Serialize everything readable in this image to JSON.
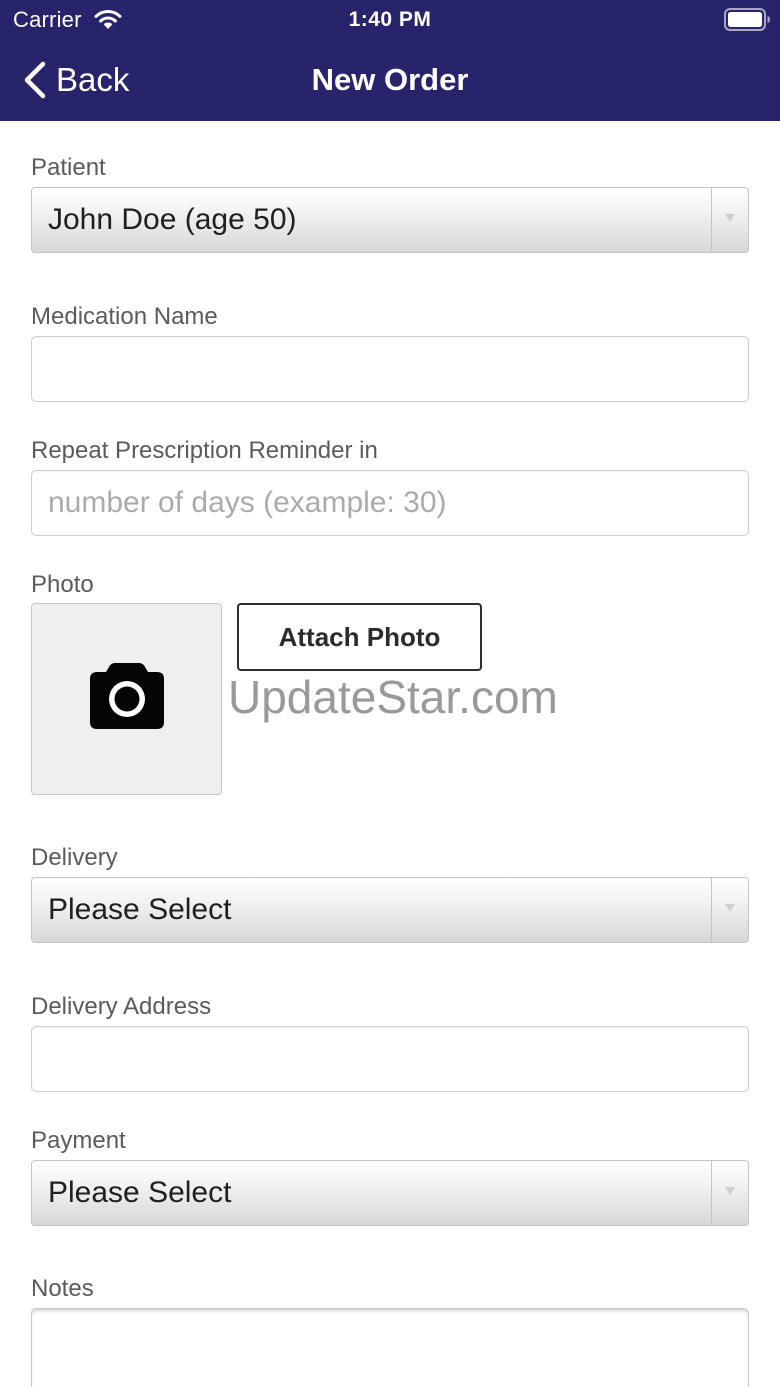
{
  "status_bar": {
    "carrier": "Carrier",
    "time": "1:40 PM",
    "wifi_icon": "wifi-icon",
    "battery_icon": "battery-icon"
  },
  "nav": {
    "back_icon": "chevron-left-icon",
    "back_label": "Back",
    "title": "New Order"
  },
  "colors": {
    "header_bg": "#28246c",
    "header_text": "#ffffff",
    "label_text": "#5b5b5b",
    "placeholder_text": "#ababab"
  },
  "form": {
    "patient": {
      "label": "Patient",
      "value": "John Doe (age 50)",
      "arrow_icon": "dropdown-arrow-icon"
    },
    "medication_name": {
      "label": "Medication Name",
      "value": ""
    },
    "reminder": {
      "label": "Repeat Prescription Reminder in",
      "value": "",
      "placeholder": "number of days (example: 30)"
    },
    "photo": {
      "label": "Photo",
      "icon": "camera-icon",
      "attach_label": "Attach Photo"
    },
    "delivery": {
      "label": "Delivery",
      "value": "Please Select",
      "arrow_icon": "dropdown-arrow-icon"
    },
    "delivery_address": {
      "label": "Delivery Address",
      "value": ""
    },
    "payment": {
      "label": "Payment",
      "value": "Please Select",
      "arrow_icon": "dropdown-arrow-icon"
    },
    "notes": {
      "label": "Notes",
      "value": ""
    }
  },
  "watermark": {
    "text": "UpdateStar.com"
  }
}
